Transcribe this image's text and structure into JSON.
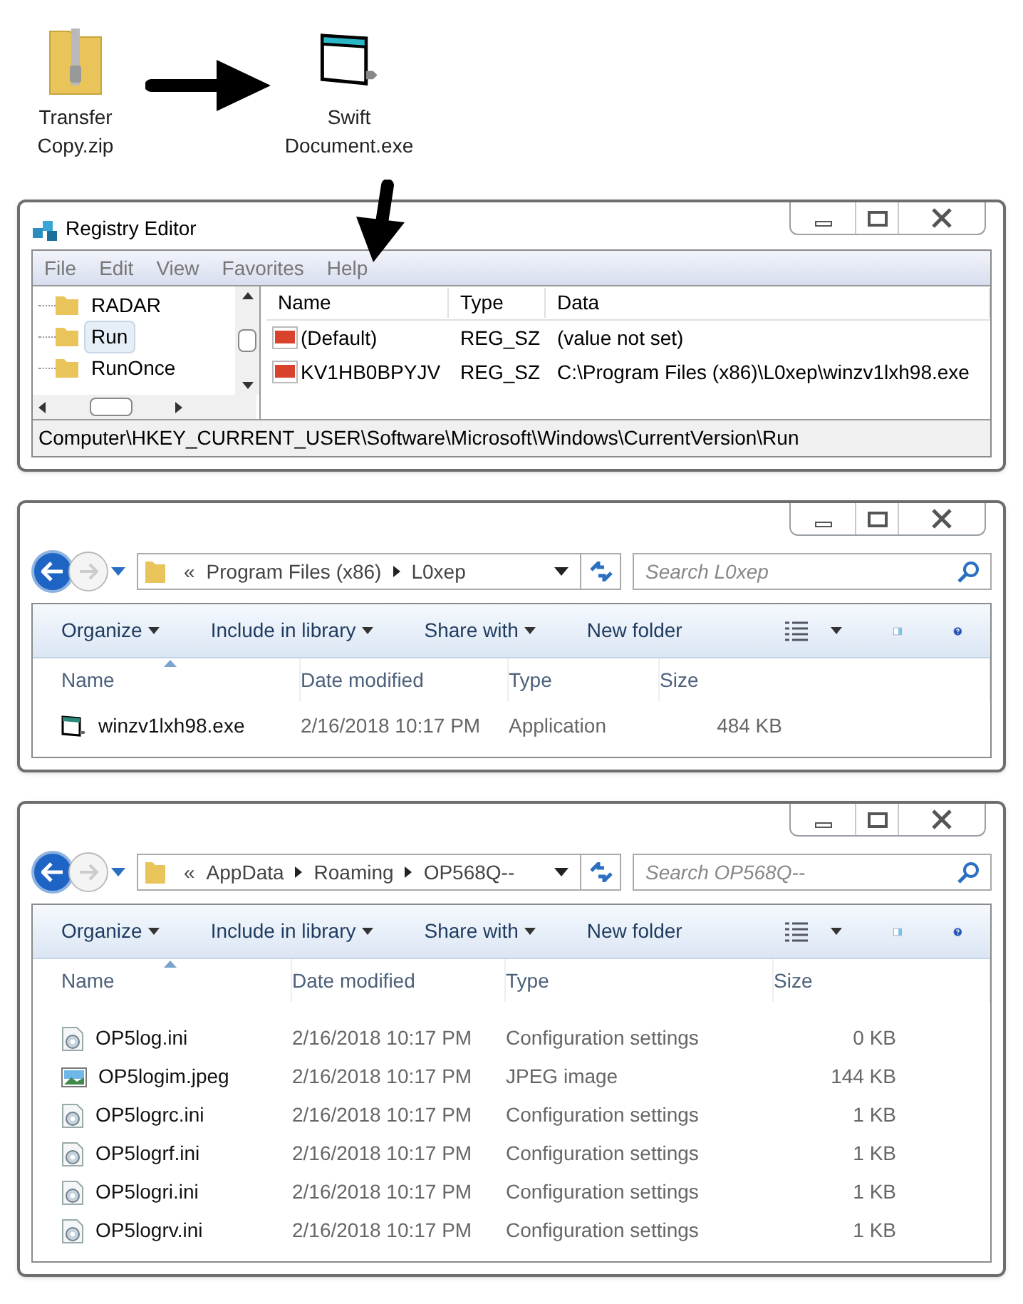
{
  "desktop_icons": [
    {
      "kind": "zip",
      "lines": [
        "Transfer",
        "Copy.zip"
      ]
    },
    {
      "kind": "exe",
      "lines": [
        "Swift",
        "Document.exe"
      ]
    }
  ],
  "registry_editor": {
    "title": "Registry Editor",
    "menu": [
      "File",
      "Edit",
      "View",
      "Favorites",
      "Help"
    ],
    "tree": [
      {
        "label": "RADAR",
        "selected": false
      },
      {
        "label": "Run",
        "selected": true
      },
      {
        "label": "RunOnce",
        "selected": false
      }
    ],
    "columns": [
      "Name",
      "Type",
      "Data"
    ],
    "rows": [
      {
        "name": "(Default)",
        "type": "REG_SZ",
        "data": "(value not set)"
      },
      {
        "name": "KV1HB0BPYJV",
        "type": "REG_SZ",
        "data": "C:\\Program Files (x86)\\L0xep\\winzv1lxh98.exe"
      }
    ],
    "status_bar": "Computer\\HKEY_CURRENT_USER\\Software\\Microsoft\\Windows\\CurrentVersion\\Run"
  },
  "explorers": [
    {
      "overflow": "«",
      "breadcrumb": [
        "Program Files (x86)",
        "L0xep"
      ],
      "search_placeholder": "Search L0xep",
      "toolbar": [
        {
          "label": "Organize",
          "dropdown": true
        },
        {
          "label": "Include in library",
          "dropdown": true
        },
        {
          "label": "Share with",
          "dropdown": true
        },
        {
          "label": "New folder",
          "dropdown": false
        }
      ],
      "columns": [
        "Name",
        "Date modified",
        "Type",
        "Size"
      ],
      "files": [
        {
          "kind": "exe",
          "name": "winzv1lxh98.exe",
          "date": "2/16/2018 10:17 PM",
          "type": "Application",
          "size": "484 KB"
        }
      ]
    },
    {
      "overflow": "«",
      "breadcrumb": [
        "AppData",
        "Roaming",
        "OP568Q--"
      ],
      "search_placeholder": "Search OP568Q--",
      "toolbar": [
        {
          "label": "Organize",
          "dropdown": true
        },
        {
          "label": "Include in library",
          "dropdown": true
        },
        {
          "label": "Share with",
          "dropdown": true
        },
        {
          "label": "New folder",
          "dropdown": false
        }
      ],
      "columns": [
        "Name",
        "Date modified",
        "Type",
        "Size"
      ],
      "files": [
        {
          "kind": "ini",
          "name": "OP5log.ini",
          "date": "2/16/2018 10:17 PM",
          "type": "Configuration settings",
          "size": "0 KB"
        },
        {
          "kind": "image",
          "name": "OP5logim.jpeg",
          "date": "2/16/2018 10:17 PM",
          "type": "JPEG image",
          "size": "144 KB"
        },
        {
          "kind": "ini",
          "name": "OP5logrc.ini",
          "date": "2/16/2018 10:17 PM",
          "type": "Configuration settings",
          "size": "1 KB"
        },
        {
          "kind": "ini",
          "name": "OP5logrf.ini",
          "date": "2/16/2018 10:17 PM",
          "type": "Configuration settings",
          "size": "1 KB"
        },
        {
          "kind": "ini",
          "name": "OP5logri.ini",
          "date": "2/16/2018 10:17 PM",
          "type": "Configuration settings",
          "size": "1 KB"
        },
        {
          "kind": "ini",
          "name": "OP5logrv.ini",
          "date": "2/16/2018 10:17 PM",
          "type": "Configuration settings",
          "size": "1 KB"
        }
      ]
    }
  ]
}
